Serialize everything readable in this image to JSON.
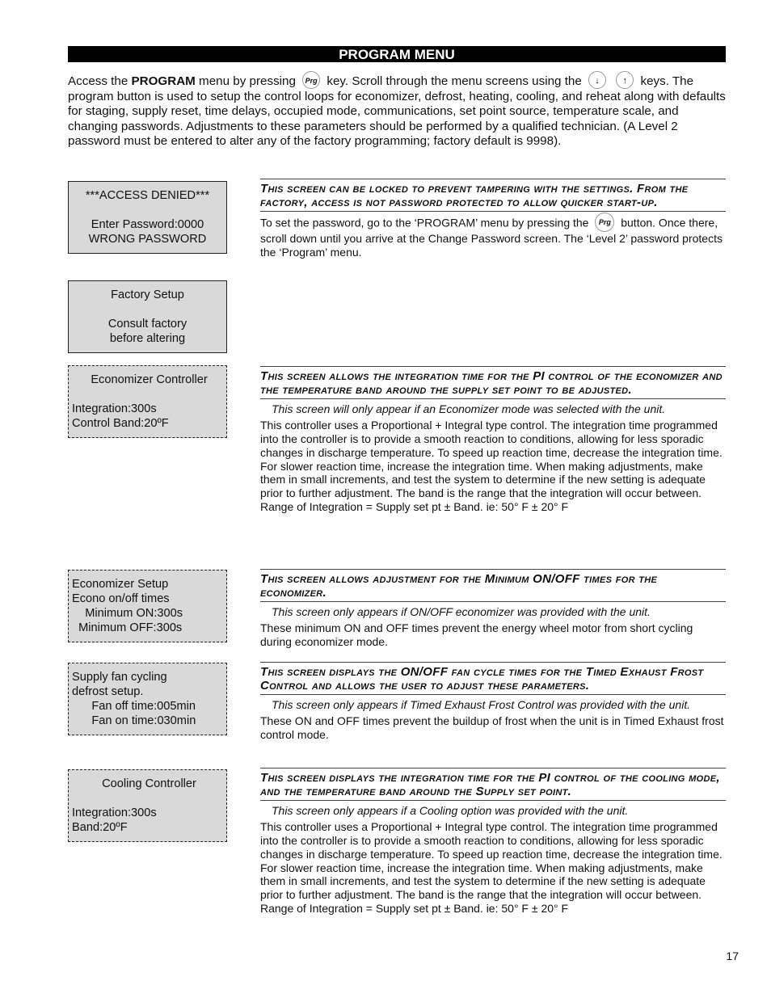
{
  "banner": {
    "title": "PROGRAM MENU"
  },
  "intro": {
    "t1": "Access the ",
    "t1_bold": "PROGRAM",
    "t2": " menu by pressing ",
    "prg_icon": "Prg",
    "t3": " key. Scroll through the menu screens using the ",
    "down_icon": "↓",
    "up_icon": "↑",
    "t4": " keys.",
    "rest": "The program button is used to setup the control loops for economizer, defrost, heating, cooling, and reheat along with defaults for staging, supply reset, time delays, occupied mode, communications, set point source, temperature scale, and changing passwords. Adjustments to these parameters should be performed by a qualified technician. (A Level 2 password must be entered to alter any of the factory programming; factory default is 9998)."
  },
  "screens": [
    {
      "name": "access-denied",
      "lines": [
        "***ACCESS DENIED***",
        "",
        "Enter Password:0000",
        "WRONG PASSWORD"
      ]
    },
    {
      "name": "factory-setup",
      "lines": [
        "Factory Setup",
        "",
        "Consult factory",
        "before altering"
      ]
    },
    {
      "name": "economizer-controller",
      "lines": [
        "Economizer Controller",
        "",
        "Integration:300s",
        "Control Band:20ºF"
      ]
    },
    {
      "name": "economizer-setup",
      "lines": [
        "Economizer Setup",
        "Econo on/off times",
        "    Minimum ON:300s",
        "  Minimum OFF:300s"
      ]
    },
    {
      "name": "supply-fan-cycling",
      "lines": [
        "Supply fan cycling",
        "defrost setup.",
        "      Fan off time:005min",
        "      Fan on time:030min"
      ]
    },
    {
      "name": "cooling-controller",
      "lines": [
        "Cooling Controller",
        "",
        "Integration:300s",
        "Band:20ºF"
      ]
    }
  ],
  "descriptions": [
    {
      "heading": "This screen can be locked to prevent tampering with the settings. From the factory, access is not password protected to allow quicker start-up.",
      "body_a": "To set the password, go to the ‘PROGRAM’ menu by pressing the ",
      "icon": "Prg",
      "body_b": " button. Once there, scroll down until you arrive at the Change Password screen. The ‘Level 2’ password protects the ‘Program’ menu."
    },
    {
      "heading": "This screen allows the integration time for the PI control of the economizer and the temperature band around the supply set point to be adjusted.",
      "note": "This screen will only appear if an Economizer mode was selected with the unit.",
      "body": "This controller uses a Proportional + Integral type control. The integration time programmed into the controller is to provide a smooth reaction to conditions, allowing for less sporadic changes in discharge temperature. To speed up reaction time, decrease the integration time. For slower reaction time, increase the integration time. When making adjustments, make them in small increments, and test the system to determine if the new setting is adequate prior to further adjustment. The band is the range that the integration will occur between.",
      "formula": "Range of Integration = Supply set pt ± Band.  ie: 50° F ± 20° F"
    },
    {
      "heading": "This screen allows adjustment for the Minimum ON/OFF times for the economizer.",
      "note": "This screen only appears if ON/OFF economizer was provided with the unit.",
      "body": "These minimum ON and OFF times prevent the energy wheel motor from short cycling during economizer mode."
    },
    {
      "heading": "This screen displays the ON/OFF fan cycle times for the Timed Exhaust Frost Control and allows the user to adjust these parameters.",
      "note": "This screen only appears if Timed Exhaust Frost Control was provided with the unit.",
      "body": "These ON and OFF times prevent the buildup of frost when the unit is in Timed Exhaust frost control mode."
    },
    {
      "heading": "This screen displays the integration time for the PI control of the cooling mode, and the temperature band around the Supply set point.",
      "note": "This screen only appears if a Cooling option was provided with the unit.",
      "body": "This controller uses a Proportional + Integral type control. The integration time programmed into the controller is to provide a smooth reaction to conditions, allowing for less sporadic changes in discharge temperature. To speed up reaction time, decrease the integration time. For slower reaction time, increase the integration time. When making adjustments, make them in small increments, and test the system to determine if the new setting is adequate prior to further adjustment. The band is the range that the integration will occur between.",
      "formula": "Range of Integration = Supply set pt ± Band.  ie: 50° F ± 20° F"
    }
  ],
  "page_number": "17"
}
